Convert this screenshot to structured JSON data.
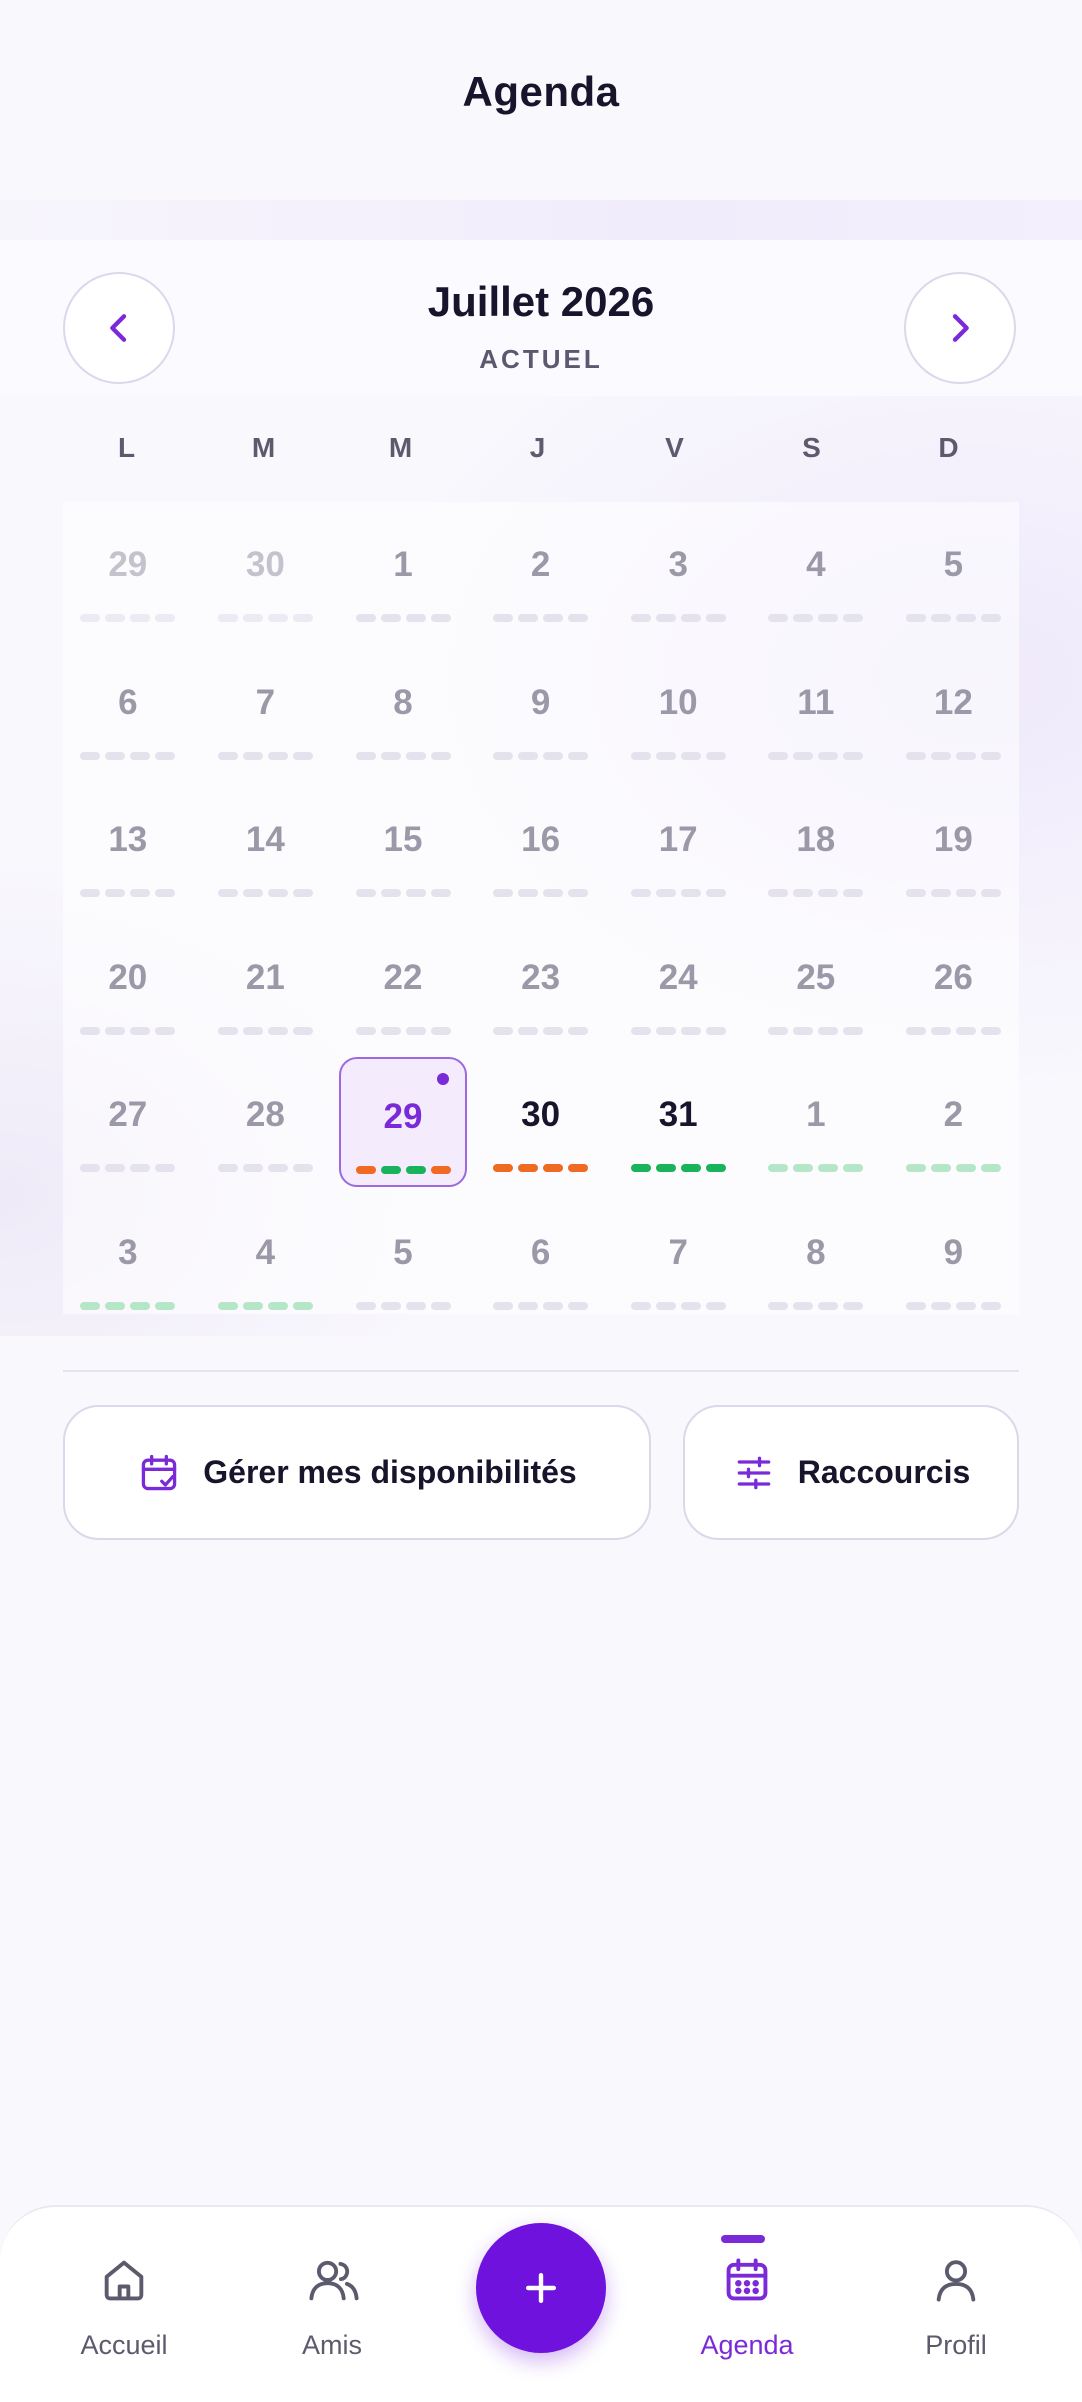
{
  "header": {
    "title": "Agenda"
  },
  "calendar": {
    "month_title": "Juillet 2026",
    "month_subtitle": "ACTUEL",
    "weekdays": [
      "L",
      "M",
      "M",
      "J",
      "V",
      "S",
      "D"
    ],
    "colors": {
      "accent": "#7b2ad8",
      "orange": "#f06a24",
      "green": "#18b35a",
      "green_light": "#b6e6c8",
      "grey": "#e4e2ec"
    },
    "weeks": [
      [
        {
          "d": "29",
          "style": "muted",
          "pills": [
            "grey",
            "grey",
            "grey",
            "grey"
          ]
        },
        {
          "d": "30",
          "style": "muted",
          "pills": [
            "grey",
            "grey",
            "grey",
            "grey"
          ]
        },
        {
          "d": "1",
          "style": "normal",
          "pills": [
            "grey",
            "grey",
            "grey",
            "grey"
          ]
        },
        {
          "d": "2",
          "style": "normal",
          "pills": [
            "grey",
            "grey",
            "grey",
            "grey"
          ]
        },
        {
          "d": "3",
          "style": "normal",
          "pills": [
            "grey",
            "grey",
            "grey",
            "grey"
          ]
        },
        {
          "d": "4",
          "style": "normal",
          "pills": [
            "grey",
            "grey",
            "grey",
            "grey"
          ]
        },
        {
          "d": "5",
          "style": "normal",
          "pills": [
            "grey",
            "grey",
            "grey",
            "grey"
          ]
        }
      ],
      [
        {
          "d": "6",
          "style": "normal",
          "pills": [
            "grey",
            "grey",
            "grey",
            "grey"
          ]
        },
        {
          "d": "7",
          "style": "normal",
          "pills": [
            "grey",
            "grey",
            "grey",
            "grey"
          ]
        },
        {
          "d": "8",
          "style": "normal",
          "pills": [
            "grey",
            "grey",
            "grey",
            "grey"
          ]
        },
        {
          "d": "9",
          "style": "normal",
          "pills": [
            "grey",
            "grey",
            "grey",
            "grey"
          ]
        },
        {
          "d": "10",
          "style": "normal",
          "pills": [
            "grey",
            "grey",
            "grey",
            "grey"
          ]
        },
        {
          "d": "11",
          "style": "normal",
          "pills": [
            "grey",
            "grey",
            "grey",
            "grey"
          ]
        },
        {
          "d": "12",
          "style": "normal",
          "pills": [
            "grey",
            "grey",
            "grey",
            "grey"
          ]
        }
      ],
      [
        {
          "d": "13",
          "style": "normal",
          "pills": [
            "grey",
            "grey",
            "grey",
            "grey"
          ]
        },
        {
          "d": "14",
          "style": "normal",
          "pills": [
            "grey",
            "grey",
            "grey",
            "grey"
          ]
        },
        {
          "d": "15",
          "style": "normal",
          "pills": [
            "grey",
            "grey",
            "grey",
            "grey"
          ]
        },
        {
          "d": "16",
          "style": "normal",
          "pills": [
            "grey",
            "grey",
            "grey",
            "grey"
          ]
        },
        {
          "d": "17",
          "style": "normal",
          "pills": [
            "grey",
            "grey",
            "grey",
            "grey"
          ]
        },
        {
          "d": "18",
          "style": "normal",
          "pills": [
            "grey",
            "grey",
            "grey",
            "grey"
          ]
        },
        {
          "d": "19",
          "style": "normal",
          "pills": [
            "grey",
            "grey",
            "grey",
            "grey"
          ]
        }
      ],
      [
        {
          "d": "20",
          "style": "normal",
          "pills": [
            "grey",
            "grey",
            "grey",
            "grey"
          ]
        },
        {
          "d": "21",
          "style": "normal",
          "pills": [
            "grey",
            "grey",
            "grey",
            "grey"
          ]
        },
        {
          "d": "22",
          "style": "normal",
          "pills": [
            "grey",
            "grey",
            "grey",
            "grey"
          ]
        },
        {
          "d": "23",
          "style": "normal",
          "pills": [
            "grey",
            "grey",
            "grey",
            "grey"
          ]
        },
        {
          "d": "24",
          "style": "normal",
          "pills": [
            "grey",
            "grey",
            "grey",
            "grey"
          ]
        },
        {
          "d": "25",
          "style": "normal",
          "pills": [
            "grey",
            "grey",
            "grey",
            "grey"
          ]
        },
        {
          "d": "26",
          "style": "normal",
          "pills": [
            "grey",
            "grey",
            "grey",
            "grey"
          ]
        }
      ],
      [
        {
          "d": "27",
          "style": "normal",
          "pills": [
            "grey",
            "grey",
            "grey",
            "grey"
          ]
        },
        {
          "d": "28",
          "style": "normal",
          "pills": [
            "grey",
            "grey",
            "grey",
            "grey"
          ]
        },
        {
          "d": "29",
          "style": "today",
          "pills": [
            "orange",
            "green",
            "green",
            "orange"
          ]
        },
        {
          "d": "30",
          "style": "strong",
          "pills": [
            "orange",
            "orange",
            "orange",
            "orange"
          ]
        },
        {
          "d": "31",
          "style": "strong",
          "pills": [
            "green",
            "green",
            "green",
            "green"
          ]
        },
        {
          "d": "1",
          "style": "normal",
          "pills": [
            "green_light",
            "green_light",
            "green_light",
            "green_light"
          ]
        },
        {
          "d": "2",
          "style": "normal",
          "pills": [
            "green_light",
            "green_light",
            "green_light",
            "green_light"
          ]
        }
      ],
      [
        {
          "d": "3",
          "style": "normal",
          "pills": [
            "green_light",
            "green_light",
            "green_light",
            "green_light"
          ]
        },
        {
          "d": "4",
          "style": "normal",
          "pills": [
            "green_light",
            "green_light",
            "green_light",
            "green_light"
          ]
        },
        {
          "d": "5",
          "style": "normal",
          "pills": [
            "grey",
            "grey",
            "grey",
            "grey"
          ]
        },
        {
          "d": "6",
          "style": "normal",
          "pills": [
            "grey",
            "grey",
            "grey",
            "grey"
          ]
        },
        {
          "d": "7",
          "style": "normal",
          "pills": [
            "grey",
            "grey",
            "grey",
            "grey"
          ]
        },
        {
          "d": "8",
          "style": "normal",
          "pills": [
            "grey",
            "grey",
            "grey",
            "grey"
          ]
        },
        {
          "d": "9",
          "style": "normal",
          "pills": [
            "grey",
            "grey",
            "grey",
            "grey"
          ]
        }
      ]
    ]
  },
  "actions": {
    "availability_label": "Gérer mes disponibilités",
    "shortcuts_label": "Raccourcis"
  },
  "tabbar": {
    "home": "Accueil",
    "friends": "Amis",
    "agenda": "Agenda",
    "profile": "Profil"
  },
  "icons": {
    "prev": "chevron-left-icon",
    "next": "chevron-right-icon",
    "availability": "calendar-check-icon",
    "shortcuts": "sliders-icon",
    "home": "home-icon",
    "friends": "users-icon",
    "add": "plus-icon",
    "agenda": "calendar-icon",
    "profile": "user-icon"
  }
}
